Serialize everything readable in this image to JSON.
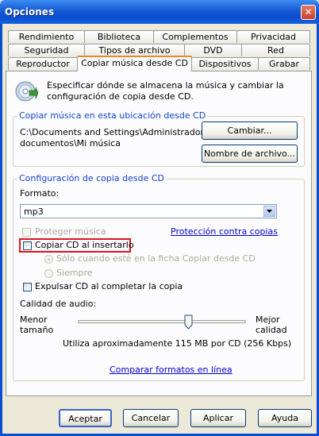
{
  "window": {
    "title": "Opciones",
    "close_glyph": "✕"
  },
  "tabs": {
    "row1": [
      "Rendimiento",
      "Biblioteca",
      "Complementos",
      "Privacidad"
    ],
    "row2": [
      "Seguridad",
      "Tipos de archivo",
      "DVD",
      "Red"
    ],
    "row3": [
      "Reproductor",
      "Copiar música desde CD",
      "Dispositivos",
      "Grabar"
    ],
    "active": "Copiar música desde CD"
  },
  "header": {
    "description_line1": "Especificar dónde se almacena la música y cambiar la",
    "description_line2": "configuración de copia desde CD.",
    "icon": "cd-rip-icon"
  },
  "location_group": {
    "title": "Copiar música en esta ubicación desde CD",
    "path_line1": "C:\\Documents and Settings\\Administrador\\Mis",
    "path_line2": "documentos\\Mi música",
    "change_button": "Cambiar...",
    "filename_button": "Nombre de archivo..."
  },
  "settings_group": {
    "title": "Configuración de copia desde CD",
    "format_label": "Formato:",
    "format_value": "mp3",
    "protect_music": "Proteger música",
    "protect_checked": false,
    "copy_protection_link": "Protección contra copias",
    "rip_on_insert": "Copiar CD al insertarlo",
    "rip_on_insert_checked": false,
    "radio_only_tab": "Sólo cuando esté en la ficha Copiar desde CD",
    "radio_always": "Siempre",
    "eject": "Expulsar CD al completar la copia",
    "eject_checked": false,
    "quality_label": "Calidad de audio:",
    "smaller_line1": "Menor",
    "smaller_line2": "tamaño",
    "better_line1": "Mejor",
    "better_line2": "calidad",
    "quality_level": 0.66,
    "usage_text": "Utiliza aproximadamente 115 MB por CD (256 Kbps)",
    "compare_link": "Comparar formatos en línea"
  },
  "footer": {
    "ok": "Aceptar",
    "cancel": "Cancelar",
    "apply": "Aplicar",
    "help": "Ayuda"
  },
  "highlight_color": "#e0141e"
}
